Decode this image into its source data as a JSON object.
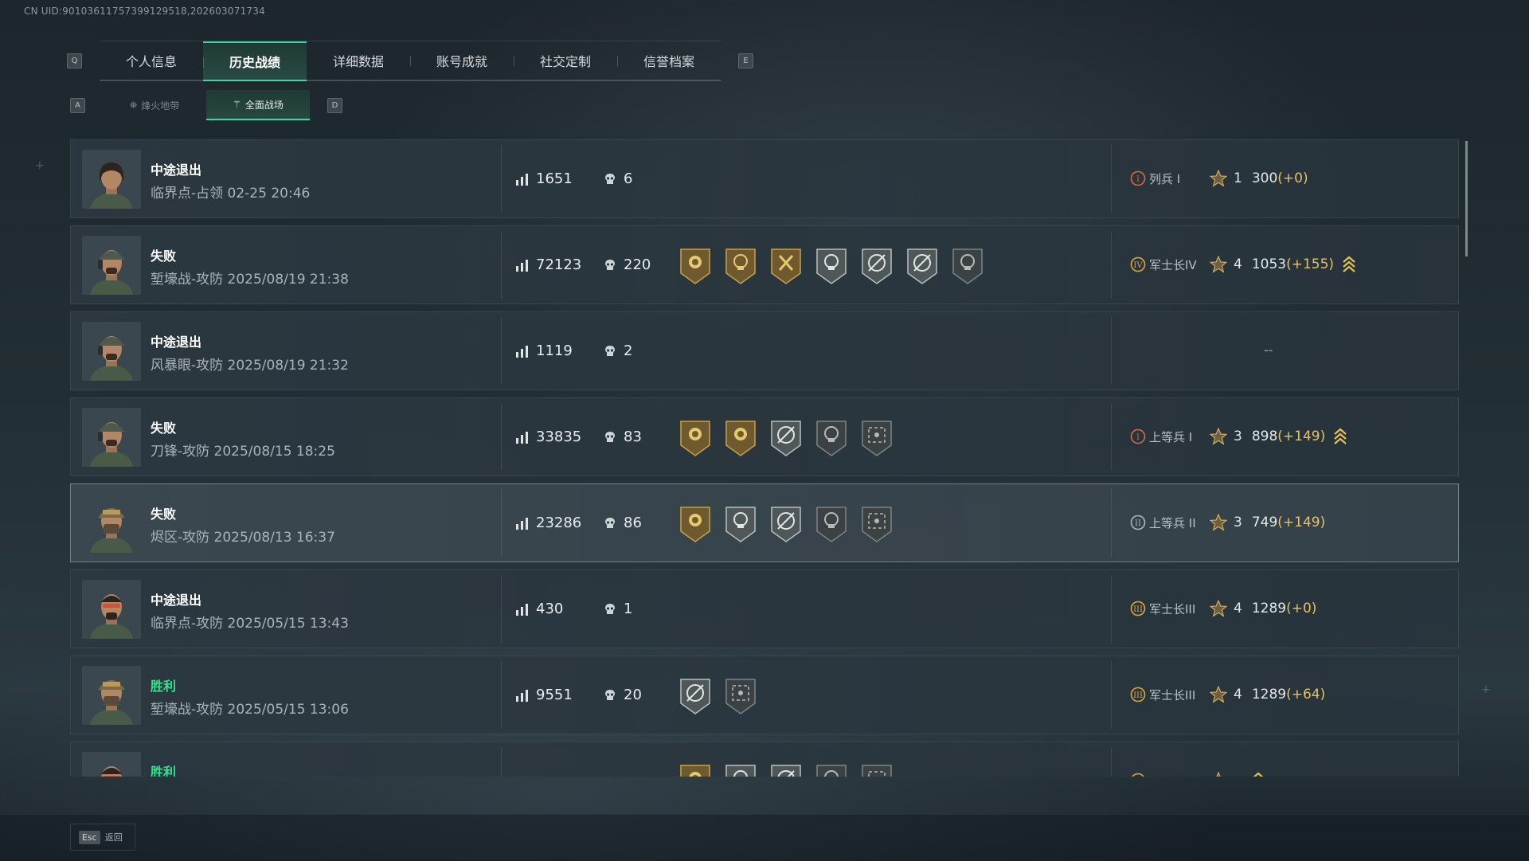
{
  "uid_text": "CN UID:9010361175739912951​8,202603071734",
  "tabs": {
    "left_key": "Q",
    "right_key": "E",
    "items": [
      "个人信息",
      "历史战绩",
      "详细数据",
      "账号成就",
      "社交定制",
      "信誉档案"
    ],
    "active_index": 1
  },
  "subtabs": {
    "left_key": "A",
    "right_key": "D",
    "items": [
      {
        "label": "烽火地带",
        "icon": "warzone-icon"
      },
      {
        "label": "全面战场",
        "icon": "battlefield-icon"
      }
    ],
    "active_index": 1
  },
  "matches": [
    {
      "result": "中途退出",
      "win": false,
      "mode": "临界点-占领 02-25 20:46",
      "score": "1651",
      "kills": "6",
      "avatar": "woman-operator",
      "badges": [],
      "rank": {
        "icon": "I",
        "name": "列兵 I",
        "level": "1",
        "points": "300",
        "delta": "(+0)",
        "promo": false
      }
    },
    {
      "result": "失败",
      "win": false,
      "mode": "堑壕战-攻防 2025/08/19 21:38",
      "score": "72123",
      "kills": "220",
      "avatar": "cap-operator",
      "badges": [
        "gold-rose",
        "gold-skull",
        "gold-hammer",
        "silver-skull",
        "silver-target",
        "silver-target",
        "dark-skull-wings"
      ],
      "rank": {
        "icon": "IV",
        "name": "军士长IV",
        "level": "4",
        "points": "1053",
        "delta": "(+155)",
        "promo": true
      }
    },
    {
      "result": "中途退出",
      "win": false,
      "mode": "风暴眼-攻防 2025/08/19 21:32",
      "score": "1119",
      "kills": "2",
      "avatar": "cap-operator",
      "badges": [],
      "rank": null,
      "rank_empty": "--"
    },
    {
      "result": "失败",
      "win": false,
      "mode": "刀锋-攻防 2025/08/15 18:25",
      "score": "33835",
      "kills": "83",
      "avatar": "headset-operator",
      "badges": [
        "gold-rose",
        "gold-heart",
        "silver-target",
        "dark-skull-wings",
        "dark-eye"
      ],
      "rank": {
        "icon": "I",
        "name": "上等兵 I",
        "level": "3",
        "points": "898",
        "delta": "(+149)",
        "promo": true
      }
    },
    {
      "result": "失败",
      "win": false,
      "mode": "烬区-攻防 2025/08/13 16:37",
      "score": "23286",
      "kills": "86",
      "avatar": "helmet-operator",
      "badges": [
        "gold-rose",
        "silver-skull",
        "silver-target",
        "dark-skull-wings",
        "dark-eye"
      ],
      "rank": {
        "icon": "II",
        "name": "上等兵 II",
        "level": "3",
        "points": "749",
        "delta": "(+149)",
        "promo": false
      }
    },
    {
      "result": "中途退出",
      "win": false,
      "mode": "临界点-攻防 2025/05/15 13:43",
      "score": "430",
      "kills": "1",
      "avatar": "glasses-operator",
      "badges": [],
      "rank": {
        "icon": "III",
        "name": "军士长III",
        "level": "4",
        "points": "1289",
        "delta": "(+0)",
        "promo": false
      }
    },
    {
      "result": "胜利",
      "win": true,
      "mode": "堑壕战-攻防 2025/05/15 13:06",
      "score": "9551",
      "kills": "20",
      "avatar": "helmet-operator",
      "badges": [
        "silver-target",
        "dark-eye"
      ],
      "rank": {
        "icon": "III",
        "name": "军士长III",
        "level": "4",
        "points": "1289",
        "delta": "(+64)",
        "promo": false
      }
    },
    {
      "result": "胜利",
      "win": true,
      "mode": "",
      "score": "",
      "kills": "",
      "avatar": "glasses-operator",
      "badges": [
        "gold-rose",
        "silver-skull",
        "silver-target",
        "dark-skull-wings",
        "dark-eye"
      ],
      "rank": {
        "icon": "III",
        "name": "",
        "level": "",
        "points": "",
        "delta": "",
        "promo": true
      }
    }
  ],
  "selected_index": 4,
  "footer": {
    "key": "Esc",
    "label": "返回"
  },
  "colors": {
    "accent": "#3ed3a4",
    "win": "#34e28e",
    "delta": "#e9c15e",
    "gold": "#c9a24a"
  }
}
